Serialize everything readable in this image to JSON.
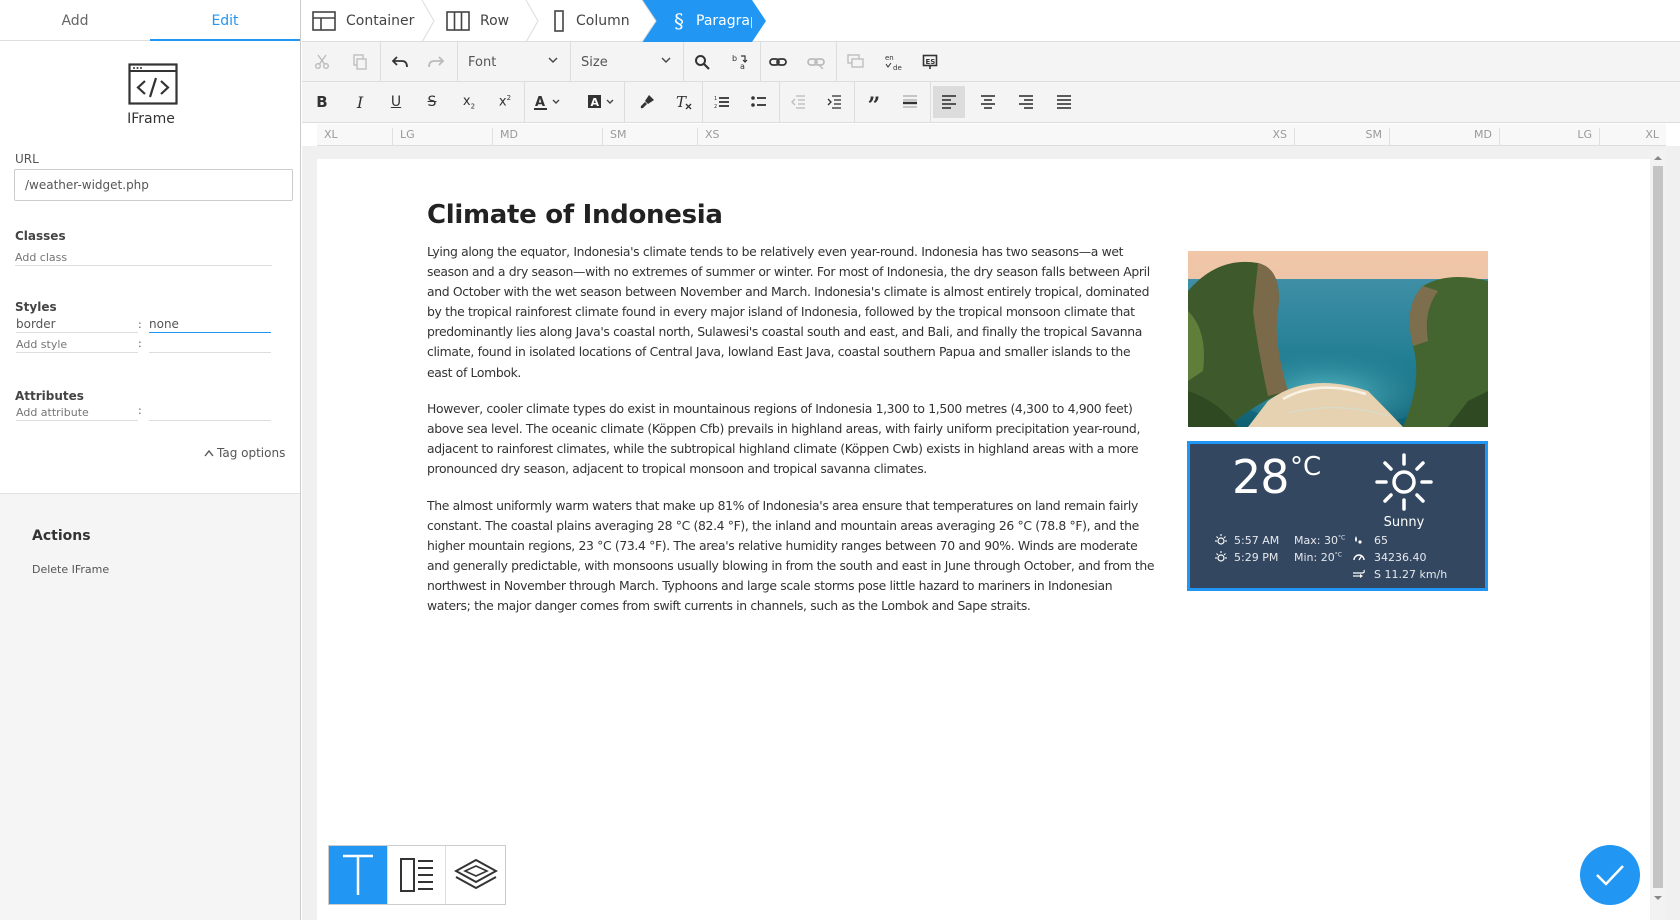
{
  "left_panel": {
    "tabs": {
      "add": "Add",
      "edit": "Edit"
    },
    "element_name": "IFrame",
    "url_label": "URL",
    "url_value": "/weather-widget.php",
    "classes_label": "Classes",
    "class_placeholder": "Add class",
    "styles_label": "Styles",
    "style_key": "border",
    "style_value": "none",
    "style_placeholder": "Add style",
    "attributes_label": "Attributes",
    "attribute_placeholder": "Add attribute",
    "tag_options": "Tag options",
    "actions_title": "Actions",
    "delete_action": "Delete IFrame"
  },
  "breadcrumb": [
    "Container",
    "Row",
    "Column",
    "Paragraph"
  ],
  "toolbar": {
    "font_label": "Font",
    "size_label": "Size"
  },
  "ruler": {
    "left": [
      "XL",
      "LG",
      "MD",
      "SM",
      "XS"
    ],
    "right": [
      "XS",
      "SM",
      "MD",
      "LG",
      "XL"
    ]
  },
  "article": {
    "title": "Climate of Indonesia",
    "paragraphs": [
      "Lying along the equator, Indonesia's climate tends to be relatively even year-round. Indonesia has two seasons—a wet season and a dry season—with no extremes of summer or winter. For most of Indonesia, the dry season falls between April and October with the wet season between November and March. Indonesia's climate is almost entirely tropical, dominated by the tropical rainforest climate found in every major island of Indonesia, followed by the tropical monsoon climate that predominantly lies along Java's coastal north, Sulawesi's coastal south and east, and Bali, and finally the tropical Savanna climate, found in isolated locations of Central Java, lowland East Java, coastal southern Papua and smaller islands to the east of Lombok.",
      "However, cooler climate types do exist in mountainous regions of Indonesia 1,300 to 1,500 metres (4,300 to 4,900 feet) above sea level. The oceanic climate (Köppen Cfb) prevails in highland areas, with fairly uniform precipitation year-round, adjacent to rainforest climates, while the subtropical highland climate (Köppen Cwb) exists in highland areas with a more pronounced dry season, adjacent to tropical monsoon and tropical savanna climates.",
      "The almost uniformly warm waters that make up 81% of Indonesia's area ensure that temperatures on land remain fairly constant. The coastal plains averaging 28 °C (82.4 °F), the inland and mountain areas averaging 26 °C (78.8 °F), and the higher mountain regions, 23 °C (73.4 °F). The area's relative humidity ranges between 70 and 90%. Winds are moderate and generally predictable, with monsoons usually blowing in from the south and east in June through October, and from the northwest in November through March. Typhoons and large scale storms pose little hazard to mariners in Indonesian waters; the major danger comes from swift currents in channels, such as the Lombok and Sape straits."
    ]
  },
  "weather": {
    "temperature": "28",
    "unit": "°C",
    "condition": "Sunny",
    "sunrise": "5:57 AM",
    "sunset": "5:29 PM",
    "max": "Max: 30",
    "min": "Min: 20",
    "deg_unit": "°C",
    "humidity": "65",
    "pressure": "34236.40",
    "wind": "S 11.27 km/h"
  },
  "colors": {
    "accent": "#2196f3",
    "weather_bg": "#344760"
  }
}
